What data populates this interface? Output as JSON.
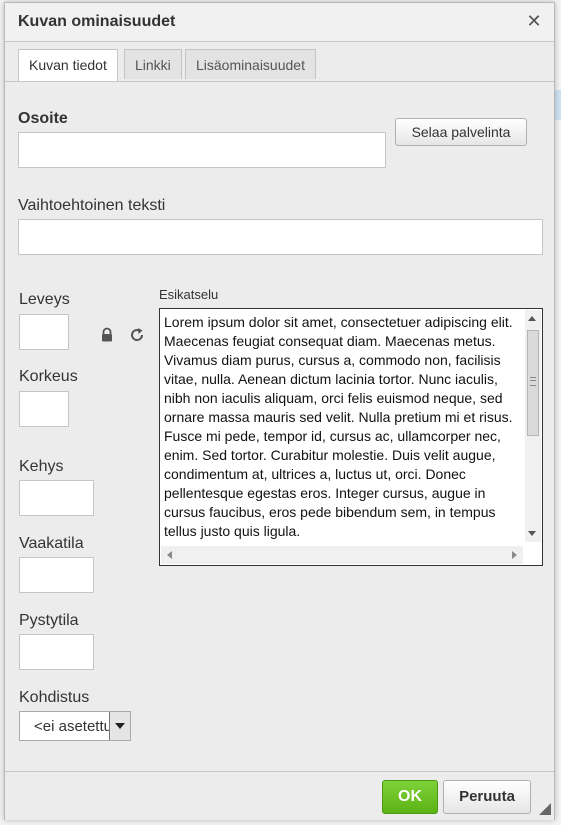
{
  "dialog": {
    "title": "Kuvan ominaisuudet",
    "close_icon": "close-icon"
  },
  "tabs": [
    {
      "label": "Kuvan tiedot",
      "active": true
    },
    {
      "label": "Linkki",
      "active": false
    },
    {
      "label": "Lisäominaisuudet",
      "active": false
    }
  ],
  "form": {
    "url_label": "Osoite",
    "url_value": "",
    "browse_label": "Selaa palvelinta",
    "alt_label": "Vaihtoehtoinen teksti",
    "alt_value": "",
    "width_label": "Leveys",
    "width_value": "",
    "lock_icon": "lock-icon",
    "reset_icon": "reset-size-icon",
    "height_label": "Korkeus",
    "height_value": "",
    "border_label": "Kehys",
    "border_value": "",
    "hspace_label": "Vaakatila",
    "hspace_value": "",
    "vspace_label": "Pystytila",
    "vspace_value": "",
    "align_label": "Kohdistus",
    "align_value": "<ei asetettu>"
  },
  "preview": {
    "label": "Esikatselu",
    "text": "Lorem ipsum dolor sit amet, consectetuer adipiscing elit. Maecenas feugiat consequat diam. Maecenas metus. Vivamus diam purus, cursus a, commodo non, facilisis vitae, nulla. Aenean dictum lacinia tortor. Nunc iaculis, nibh non iaculis aliquam, orci felis euismod neque, sed ornare massa mauris sed velit. Nulla pretium mi et risus. Fusce mi pede, tempor id, cursus ac, ullamcorper nec, enim. Sed tortor. Curabitur molestie. Duis velit augue, condimentum at, ultrices a, luctus ut, orci. Donec pellentesque egestas eros. Integer cursus, augue in cursus faucibus, eros pede bibendum sem, in tempus tellus justo quis ligula."
  },
  "footer": {
    "ok_label": "OK",
    "cancel_label": "Peruuta"
  },
  "colors": {
    "ok_green": "#5cb314",
    "dialog_bg": "#ececec"
  }
}
